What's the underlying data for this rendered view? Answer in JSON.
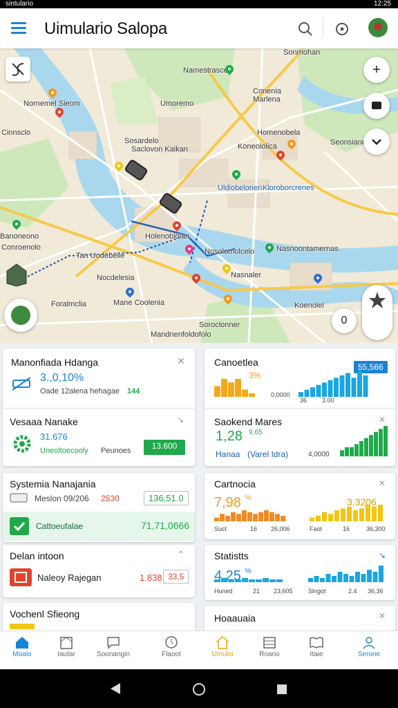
{
  "status_bar": {
    "left_text": "sintulario",
    "right_text": "12:25"
  },
  "app": {
    "title": "Uimulario Salopa"
  },
  "icons": {
    "menu": "hamburger-icon",
    "search": "search-icon",
    "locate": "locate-icon",
    "avatar": "avatar-icon",
    "layers": "layers-icon",
    "zoom_in": "plus-icon",
    "chat": "chat-icon",
    "collapse": "chevron-down-icon",
    "star": "star-icon"
  },
  "colors": {
    "accent": "#1a84d4",
    "green": "#1fa94a",
    "orange": "#f19a1b",
    "red": "#e0442c",
    "yellow": "#f2c511",
    "water": "#a9d8ee",
    "park": "#cfe8bb"
  },
  "map": {
    "labels": [
      "Sonmohan",
      "Namestrasce",
      "Nornemel Sieom",
      "Conenia Marlena",
      "Umoremo",
      "Cinnsclo",
      "Sosardelo",
      "Homenobela",
      "Saclovon Kaikan",
      "Koneololica",
      "Seonsianodle",
      "Uldiobelonen",
      "Kloroborcrenes",
      "Nasnoontamernas",
      "Banoneono",
      "Tan Uodebelie",
      "Holenoblolan",
      "Nosolomolcelo",
      "Nocdelesia",
      "Foralmclia",
      "Mane Coolenia",
      "Nasnaler",
      "Koenolel",
      "Soroclonner",
      "Mandnenfoldofolo",
      "Conroenolo"
    ],
    "zoom_label": "+",
    "fab_chat_label": "0"
  },
  "cards": {
    "c1": {
      "title": "Manonfiada Hdanga",
      "value": "3.,0,10%",
      "sub": "Oade 12alena hehagae",
      "sub_value": "144"
    },
    "c2": {
      "title": "Vesaaa Nanake",
      "value": "31.676",
      "sub1": "Uneoltoecooly",
      "sub2": "Peunoes",
      "badge": "13.600"
    },
    "c3": {
      "title": "Systemia Nanajania",
      "sub": "Meslon 09/206",
      "sub_value": "2530",
      "value": "136,51.0"
    },
    "c4": {
      "title": "Cattoeufalae",
      "value": "71,71,0666"
    },
    "c5": {
      "title": "Delan intoon",
      "sub": "Naleoy Rajegan",
      "value": "1.838",
      "badge": "33,5"
    },
    "c6": {
      "title": "Vochenl Sfieong"
    },
    "r1": {
      "title": "Canoetlea",
      "value": "3%",
      "badge": "55,566",
      "label_a": "0,0000",
      "label_b": "36",
      "label_c": "3.00"
    },
    "r2": {
      "title": "Saokend Mares",
      "value": "1,28",
      "sub_value": "9,65",
      "label_a": "Hanaa",
      "label_b": "(Varel Idra)",
      "label_c": "4,0000"
    },
    "r3": {
      "title": "Cartnocia",
      "value": "7,98",
      "pct": "%",
      "value2": "3,3206",
      "label_a": "Suct",
      "label_b": "16",
      "label_c": "26,006",
      "label_d": "Faot",
      "label_e": "16",
      "label_f": "36,300"
    },
    "r4": {
      "title": "Statistts",
      "value": "4,25",
      "pct": "%",
      "label_a": "Huned",
      "label_b": "21",
      "label_c": "23,605",
      "label_d": "Slngot",
      "label_e": "2.4",
      "label_f": "36,36"
    },
    "r5": {
      "title": "Hoaauaia"
    }
  },
  "chart_data": [
    {
      "type": "bar",
      "title": "Canoetlea",
      "series": [
        {
          "values": [
            3,
            5,
            4,
            5,
            2,
            1
          ]
        },
        {
          "values": [
            2,
            3,
            4,
            5,
            6,
            7,
            8,
            9,
            10,
            8,
            11,
            9
          ]
        }
      ]
    },
    {
      "type": "bar",
      "title": "Saokend Mares",
      "series": [
        {
          "values": [
            2,
            3,
            3,
            4,
            5,
            6,
            7,
            8,
            9,
            10
          ]
        }
      ]
    },
    {
      "type": "bar",
      "title": "Cartnocia",
      "series": [
        {
          "values": [
            2,
            4,
            3,
            5,
            4,
            6,
            5,
            4,
            5,
            6,
            5,
            4,
            3
          ]
        },
        {
          "values": [
            2,
            3,
            5,
            4,
            6,
            7,
            8,
            6,
            7,
            9,
            8,
            9
          ]
        }
      ]
    },
    {
      "type": "bar",
      "title": "Statistts",
      "series": [
        {
          "values": [
            2,
            3,
            2,
            2,
            3,
            2,
            2,
            3,
            2,
            2
          ]
        },
        {
          "values": [
            2,
            3,
            2,
            4,
            3,
            5,
            4,
            3,
            5,
            4,
            6,
            5,
            8
          ]
        }
      ]
    }
  ],
  "bottom_nav": [
    {
      "label": "Moalo"
    },
    {
      "label": "Iautar"
    },
    {
      "label": "Soonangin"
    },
    {
      "label": "Flaoot"
    },
    {
      "label": "Umulio"
    },
    {
      "label": "Roano"
    },
    {
      "label": "Itaie"
    },
    {
      "label": "Serone"
    }
  ]
}
